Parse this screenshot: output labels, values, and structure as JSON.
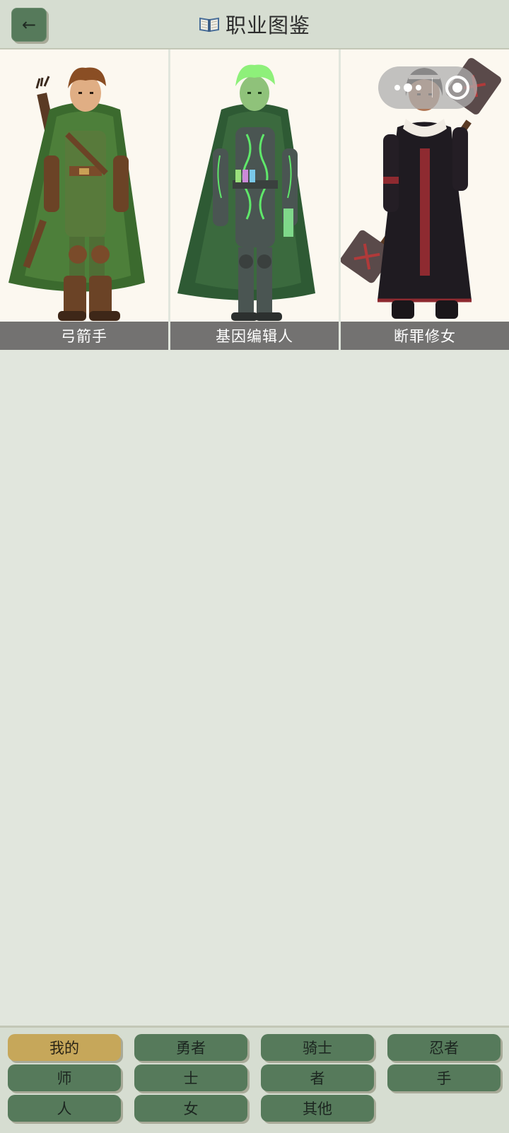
{
  "header": {
    "back_symbol": "←",
    "title": "职业图鉴",
    "book_icon": "open-book-icon"
  },
  "capsule": {
    "more_icon": "more-dots-icon",
    "close_icon": "target-circle-icon"
  },
  "classes": [
    {
      "name": "弓箭手",
      "icon": "archer-portrait"
    },
    {
      "name": "基因编辑人",
      "icon": "gene-editor-portrait"
    },
    {
      "name": "断罪修女",
      "icon": "judgment-nun-portrait"
    }
  ],
  "filters": {
    "active": "我的",
    "buttons": [
      "我的",
      "勇者",
      "骑士",
      "忍者",
      "师",
      "士",
      "者",
      "手",
      "人",
      "女",
      "其他"
    ]
  },
  "colors": {
    "button_green": "#567a5b",
    "button_active": "#c6a75a",
    "background": "#e1e6dd"
  }
}
